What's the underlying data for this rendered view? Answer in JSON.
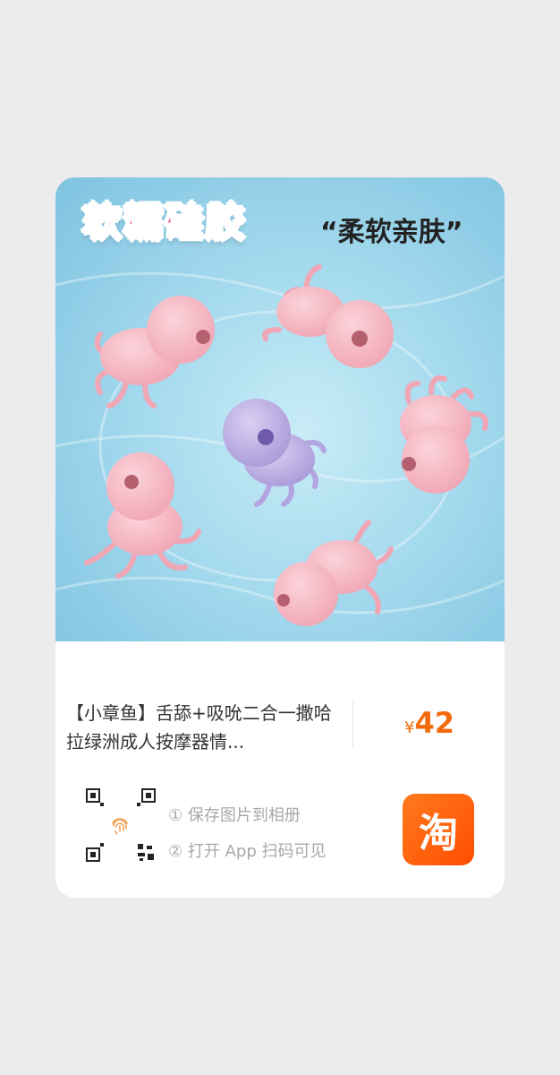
{
  "image": {
    "headline_main": "软糯硅胶",
    "headline_sub": "“柔软亲肤”"
  },
  "product": {
    "title": "【小章鱼】舌舔+吸吮二合一撒哈拉绿洲成人按摩器情...",
    "currency": "¥",
    "price": "42"
  },
  "instructions": {
    "step1": "① 保存图片到相册",
    "step2": "② 打开 App 扫码可见"
  },
  "taobao": {
    "label": "淘"
  },
  "colors": {
    "price": "#f36b0d",
    "brand": "#ff5500",
    "headline": "#ef4f6a"
  }
}
